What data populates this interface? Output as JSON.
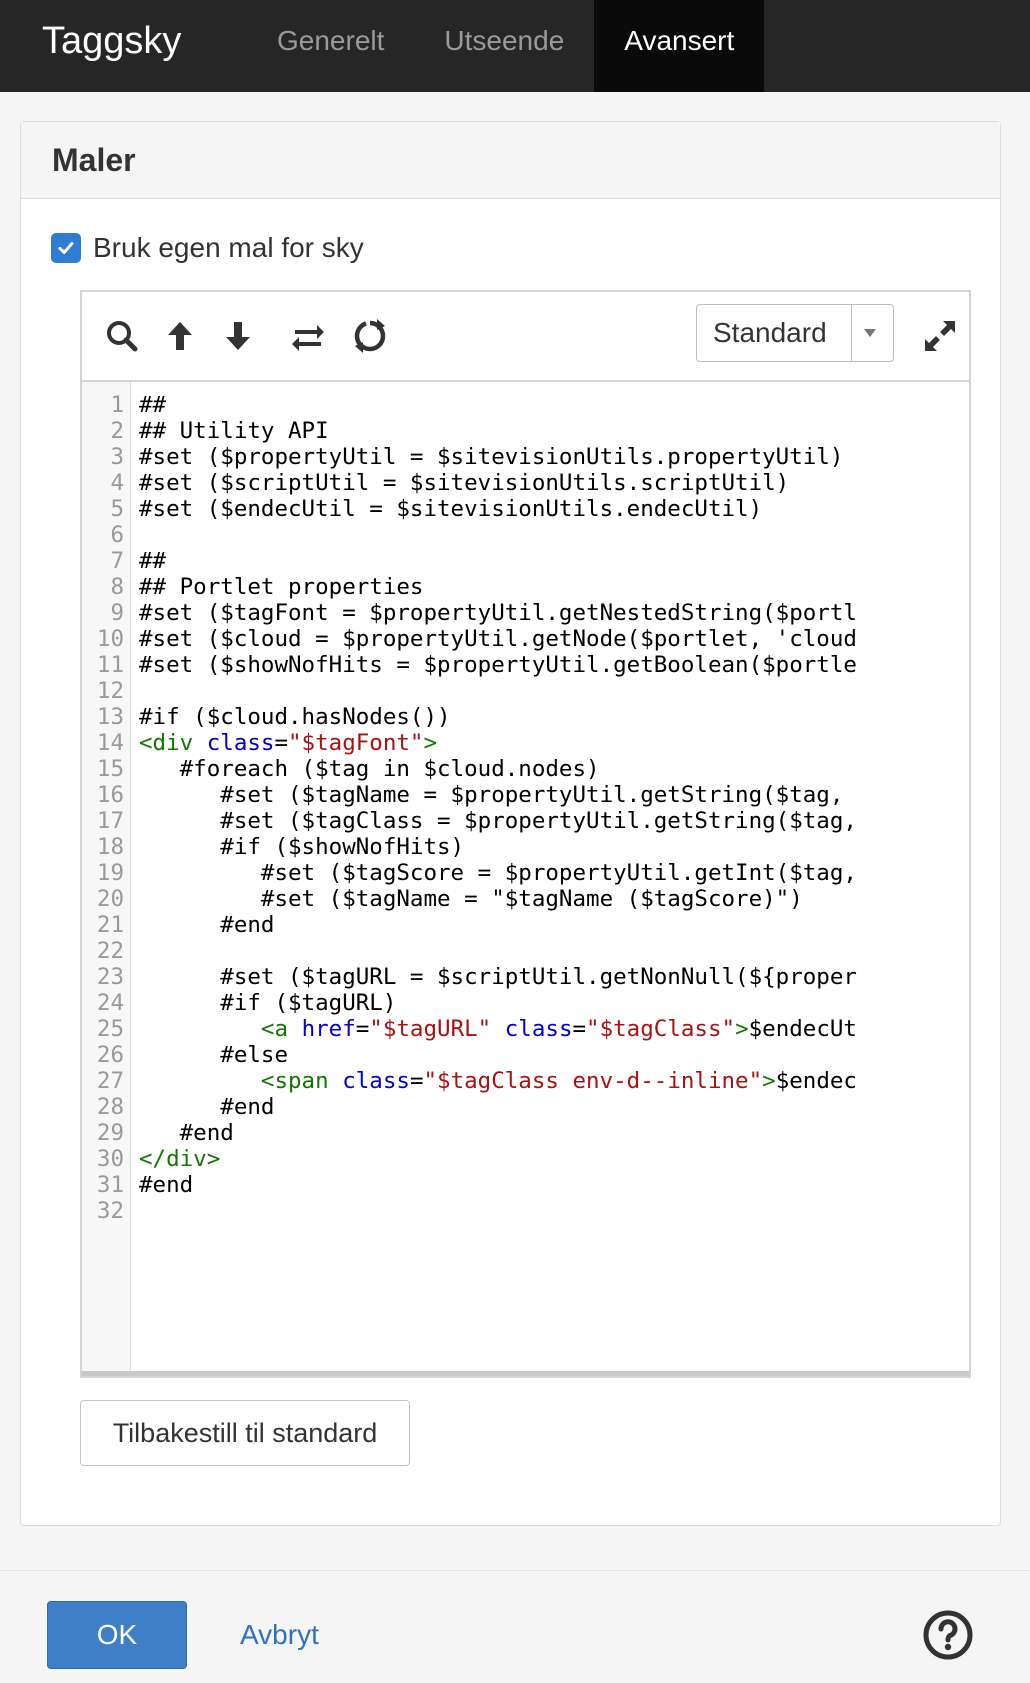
{
  "header": {
    "title": "Taggsky",
    "tabs": [
      {
        "label": "Generelt",
        "active": false
      },
      {
        "label": "Utseende",
        "active": false
      },
      {
        "label": "Avansert",
        "active": true
      }
    ]
  },
  "panel": {
    "title": "Maler",
    "checkbox": {
      "label": "Bruk egen mal for sky",
      "checked": true
    },
    "editor": {
      "toolbar": {
        "icons": [
          "search-icon",
          "arrow-up-icon",
          "arrow-down-icon",
          "replace-icon",
          "refresh-icon",
          "expand-icon"
        ],
        "select_value": "Standard"
      },
      "line_numbers": [
        "1",
        "2",
        "3",
        "4",
        "5",
        "6",
        "7",
        "8",
        "9",
        "10",
        "11",
        "12",
        "13",
        "14",
        "15",
        "16",
        "17",
        "18",
        "19",
        "20",
        "21",
        "22",
        "23",
        "24",
        "25",
        "26",
        "27",
        "28",
        "29",
        "30",
        "31",
        "32"
      ],
      "lines": [
        "##",
        "## Utility API",
        "#set ($propertyUtil = $sitevisionUtils.propertyUtil)",
        "#set ($scriptUtil = $sitevisionUtils.scriptUtil)",
        "#set ($endecUtil = $sitevisionUtils.endecUtil)",
        "",
        "##",
        "## Portlet properties",
        "#set ($tagFont = $propertyUtil.getNestedString($portl",
        "#set ($cloud = $propertyUtil.getNode($portlet, 'cloud",
        "#set ($showNofHits = $propertyUtil.getBoolean($portle",
        "",
        "#if ($cloud.hasNodes())",
        "",
        "   #foreach ($tag in $cloud.nodes)",
        "      #set ($tagName = $propertyUtil.getString($tag,",
        "      #set ($tagClass = $propertyUtil.getString($tag,",
        "      #if ($showNofHits)",
        "         #set ($tagScore = $propertyUtil.getInt($tag,",
        "         #set ($tagName = \"$tagName ($tagScore)\")",
        "      #end",
        "",
        "      #set ($tagURL = $scriptUtil.getNonNull(${proper",
        "      #if ($tagURL)",
        "",
        "      #else",
        "",
        "      #end",
        "   #end",
        "",
        "#end",
        ""
      ],
      "html_lines": {
        "line14": {
          "open": "<div",
          "attr": "class",
          "eq": "=",
          "val": "\"$tagFont\"",
          "close": ">"
        },
        "line25": {
          "indent": "         ",
          "open": "<a",
          "attr1": "href",
          "eq1": "=",
          "val1": "\"$tagURL\"",
          "attr2": "class",
          "eq2": "=",
          "val2": "\"$tagClass\"",
          "close": ">",
          "rest": "$endecUt"
        },
        "line27": {
          "indent": "         ",
          "open": "<span",
          "attr": "class",
          "eq": "=",
          "val": "\"$tagClass env-d--inline\"",
          "close": ">",
          "rest": "$endec"
        },
        "line30": {
          "tag": "</div>"
        }
      }
    },
    "reset_button": "Tilbakestill til standard"
  },
  "footer": {
    "ok_label": "OK",
    "cancel_label": "Avbryt",
    "help_icon": "help-icon"
  },
  "colors": {
    "accent": "#3e7fc7",
    "topbar": "#262626",
    "checkbox": "#2f7bd6",
    "tag": "#117700",
    "attr": "#0000cc",
    "string": "#aa1111"
  }
}
